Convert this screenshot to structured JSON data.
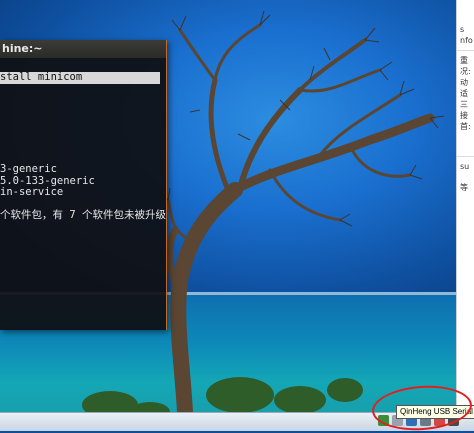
{
  "terminal": {
    "title": "hine:~",
    "lines": [
      "stall minicom",
      "",
      "",
      "",
      "3-generic",
      "5.0-133-generic",
      "in-service",
      "",
      "个软件包，有 7 个软件包未被升级"
    ],
    "highlighted_line_index": 0
  },
  "side_panel": {
    "lines": [
      "s",
      "nfo",
      "重",
      "况:",
      "动",
      "适",
      "三",
      "接",
      "首:",
      "su",
      "等"
    ]
  },
  "taskbar": {
    "tooltip": "QinHeng USB Serial"
  },
  "colors": {
    "annotation": "#e02020",
    "terminal_border": "#c46a2a"
  }
}
